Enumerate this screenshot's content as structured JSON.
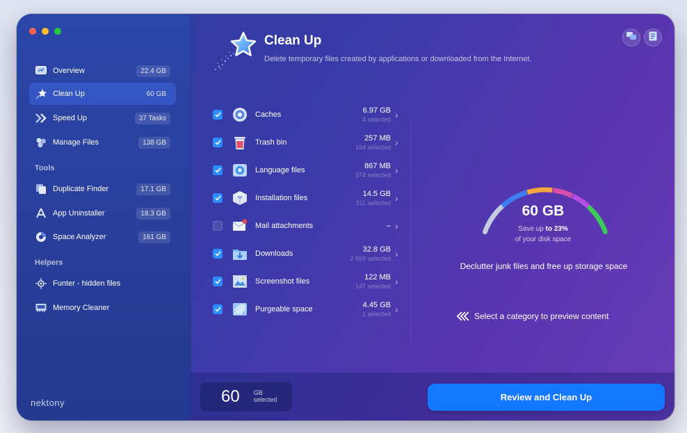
{
  "sidebar": {
    "items": [
      {
        "label": "Overview",
        "badge": "22.4 GB",
        "icon": "overview-icon"
      },
      {
        "label": "Clean Up",
        "badge": "60 GB",
        "icon": "cleanup-star-icon"
      },
      {
        "label": "Speed Up",
        "badge": "37 Tasks",
        "icon": "speedup-icon"
      },
      {
        "label": "Manage Files",
        "badge": "138 GB",
        "icon": "manage-files-icon"
      }
    ],
    "tools_heading": "Tools",
    "tools": [
      {
        "label": "Duplicate Finder",
        "badge": "17.1 GB",
        "icon": "duplicate-finder-icon"
      },
      {
        "label": "App Uninstaller",
        "badge": "18.3 GB",
        "icon": "app-uninstaller-icon"
      },
      {
        "label": "Space Analyzer",
        "badge": "161 GB",
        "icon": "space-analyzer-icon"
      }
    ],
    "helpers_heading": "Helpers",
    "helpers": [
      {
        "label": "Funter - hidden files",
        "icon": "funter-icon"
      },
      {
        "label": "Memory Cleaner",
        "icon": "memory-cleaner-icon"
      }
    ],
    "brand": "nektony"
  },
  "header": {
    "title": "Clean Up",
    "subtitle": "Delete temporary files created by applications or downloaded from the Internet."
  },
  "categories": [
    {
      "label": "Caches",
      "size": "6.97 GB",
      "selected": "4 selected",
      "checked": true,
      "icon": "caches-icon"
    },
    {
      "label": "Trash bin",
      "size": "257 MB",
      "selected": "194 selected",
      "checked": true,
      "icon": "trash-icon"
    },
    {
      "label": "Language files",
      "size": "867 MB",
      "selected": "374 selected",
      "checked": true,
      "icon": "language-files-icon"
    },
    {
      "label": "Installation files",
      "size": "14.5 GB",
      "selected": "311 selected",
      "checked": true,
      "icon": "installation-files-icon"
    },
    {
      "label": "Mail attachments",
      "size": "–",
      "selected": "",
      "checked": false,
      "icon": "mail-icon"
    },
    {
      "label": "Downloads",
      "size": "32.8 GB",
      "selected": "2 659 selected",
      "checked": true,
      "icon": "downloads-icon"
    },
    {
      "label": "Screenshot files",
      "size": "122 MB",
      "selected": "147 selected",
      "checked": true,
      "icon": "screenshot-icon"
    },
    {
      "label": "Purgeable space",
      "size": "4.45 GB",
      "selected": "1 selected",
      "checked": true,
      "icon": "purgeable-icon"
    }
  ],
  "gauge": {
    "value": "60 GB",
    "save_prefix": "Save up ",
    "save_to": "to 23%",
    "disk_line": "of your disk space",
    "percent": 23,
    "colors": [
      "#c4cbe0",
      "#3d7ef2",
      "#f4a640",
      "#d94fa8",
      "#b44ce6",
      "#3cc85a"
    ]
  },
  "declutter": "Declutter junk files and free up storage space",
  "preview_hint": "Select a category to preview content",
  "footer": {
    "number": "60",
    "unit": "GB",
    "unit_sub": "selected",
    "button": "Review and Clean Up"
  },
  "colors": {
    "accent": "#1477ff",
    "checkbox": "#2d8cff"
  }
}
